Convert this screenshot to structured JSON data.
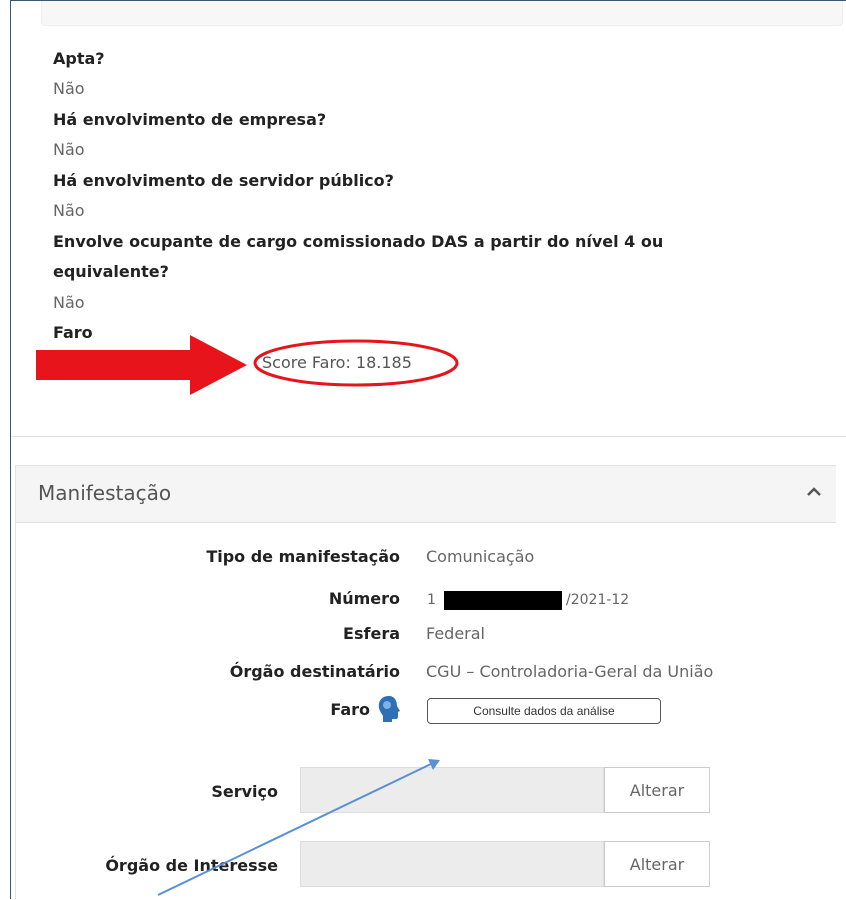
{
  "details": {
    "q1": "Apta?",
    "a1": "Não",
    "q2": "Há envolvimento de empresa?",
    "a2": "Não",
    "q3": "Há envolvimento de servidor público?",
    "a3": "Não",
    "q4_line1": "Envolve ocupante de cargo comissionado DAS a partir do nível 4 ou",
    "q4_line2": "equivalente?",
    "a4": "Não",
    "faro_label": "Faro",
    "score": "Score Faro: 18.185"
  },
  "manifestacao": {
    "title": "Manifestação",
    "tipo_label": "Tipo de manifestação",
    "tipo_value": "Comunicação",
    "numero_label": "Número",
    "numero_prefix": "1",
    "numero_suffix": "/2021-12",
    "esfera_label": "Esfera",
    "esfera_value": "Federal",
    "orgao_label": "Órgão destinatário",
    "orgao_value": "CGU – Controladoria-Geral da União",
    "faro_label": "Faro",
    "consult_button": "Consulte dados da análise",
    "servico_label": "Serviço",
    "servico_value": "",
    "orgao_interesse_label": "Órgão de Interesse",
    "orgao_interesse_value": "",
    "alterar": "Alterar"
  },
  "colors": {
    "annotation_red": "#e8141b",
    "annotation_blue": "#5b8fd6",
    "faro_icon": "#2f6fb5"
  }
}
